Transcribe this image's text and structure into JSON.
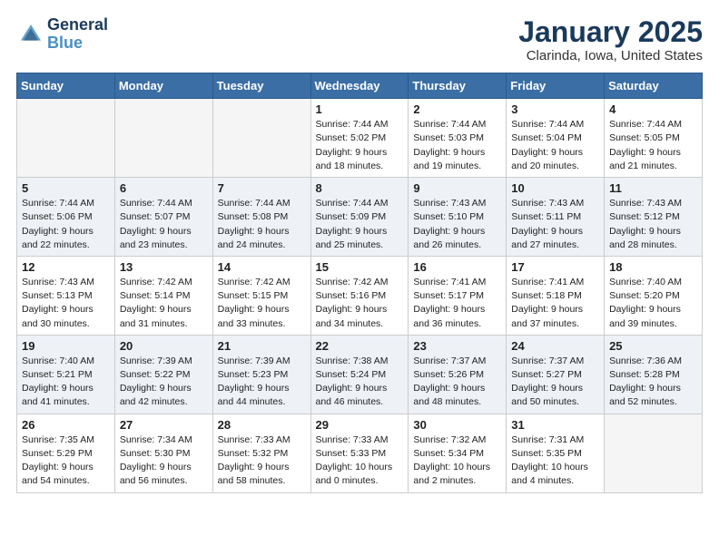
{
  "logo": {
    "line1": "General",
    "line2": "Blue"
  },
  "title": "January 2025",
  "location": "Clarinda, Iowa, United States",
  "days_of_week": [
    "Sunday",
    "Monday",
    "Tuesday",
    "Wednesday",
    "Thursday",
    "Friday",
    "Saturday"
  ],
  "weeks": [
    [
      {
        "day": "",
        "sunrise": "",
        "sunset": "",
        "daylight": "",
        "empty": true
      },
      {
        "day": "",
        "sunrise": "",
        "sunset": "",
        "daylight": "",
        "empty": true
      },
      {
        "day": "",
        "sunrise": "",
        "sunset": "",
        "daylight": "",
        "empty": true
      },
      {
        "day": "1",
        "sunrise": "Sunrise: 7:44 AM",
        "sunset": "Sunset: 5:02 PM",
        "daylight": "Daylight: 9 hours and 18 minutes.",
        "empty": false
      },
      {
        "day": "2",
        "sunrise": "Sunrise: 7:44 AM",
        "sunset": "Sunset: 5:03 PM",
        "daylight": "Daylight: 9 hours and 19 minutes.",
        "empty": false
      },
      {
        "day": "3",
        "sunrise": "Sunrise: 7:44 AM",
        "sunset": "Sunset: 5:04 PM",
        "daylight": "Daylight: 9 hours and 20 minutes.",
        "empty": false
      },
      {
        "day": "4",
        "sunrise": "Sunrise: 7:44 AM",
        "sunset": "Sunset: 5:05 PM",
        "daylight": "Daylight: 9 hours and 21 minutes.",
        "empty": false
      }
    ],
    [
      {
        "day": "5",
        "sunrise": "Sunrise: 7:44 AM",
        "sunset": "Sunset: 5:06 PM",
        "daylight": "Daylight: 9 hours and 22 minutes.",
        "empty": false
      },
      {
        "day": "6",
        "sunrise": "Sunrise: 7:44 AM",
        "sunset": "Sunset: 5:07 PM",
        "daylight": "Daylight: 9 hours and 23 minutes.",
        "empty": false
      },
      {
        "day": "7",
        "sunrise": "Sunrise: 7:44 AM",
        "sunset": "Sunset: 5:08 PM",
        "daylight": "Daylight: 9 hours and 24 minutes.",
        "empty": false
      },
      {
        "day": "8",
        "sunrise": "Sunrise: 7:44 AM",
        "sunset": "Sunset: 5:09 PM",
        "daylight": "Daylight: 9 hours and 25 minutes.",
        "empty": false
      },
      {
        "day": "9",
        "sunrise": "Sunrise: 7:43 AM",
        "sunset": "Sunset: 5:10 PM",
        "daylight": "Daylight: 9 hours and 26 minutes.",
        "empty": false
      },
      {
        "day": "10",
        "sunrise": "Sunrise: 7:43 AM",
        "sunset": "Sunset: 5:11 PM",
        "daylight": "Daylight: 9 hours and 27 minutes.",
        "empty": false
      },
      {
        "day": "11",
        "sunrise": "Sunrise: 7:43 AM",
        "sunset": "Sunset: 5:12 PM",
        "daylight": "Daylight: 9 hours and 28 minutes.",
        "empty": false
      }
    ],
    [
      {
        "day": "12",
        "sunrise": "Sunrise: 7:43 AM",
        "sunset": "Sunset: 5:13 PM",
        "daylight": "Daylight: 9 hours and 30 minutes.",
        "empty": false
      },
      {
        "day": "13",
        "sunrise": "Sunrise: 7:42 AM",
        "sunset": "Sunset: 5:14 PM",
        "daylight": "Daylight: 9 hours and 31 minutes.",
        "empty": false
      },
      {
        "day": "14",
        "sunrise": "Sunrise: 7:42 AM",
        "sunset": "Sunset: 5:15 PM",
        "daylight": "Daylight: 9 hours and 33 minutes.",
        "empty": false
      },
      {
        "day": "15",
        "sunrise": "Sunrise: 7:42 AM",
        "sunset": "Sunset: 5:16 PM",
        "daylight": "Daylight: 9 hours and 34 minutes.",
        "empty": false
      },
      {
        "day": "16",
        "sunrise": "Sunrise: 7:41 AM",
        "sunset": "Sunset: 5:17 PM",
        "daylight": "Daylight: 9 hours and 36 minutes.",
        "empty": false
      },
      {
        "day": "17",
        "sunrise": "Sunrise: 7:41 AM",
        "sunset": "Sunset: 5:18 PM",
        "daylight": "Daylight: 9 hours and 37 minutes.",
        "empty": false
      },
      {
        "day": "18",
        "sunrise": "Sunrise: 7:40 AM",
        "sunset": "Sunset: 5:20 PM",
        "daylight": "Daylight: 9 hours and 39 minutes.",
        "empty": false
      }
    ],
    [
      {
        "day": "19",
        "sunrise": "Sunrise: 7:40 AM",
        "sunset": "Sunset: 5:21 PM",
        "daylight": "Daylight: 9 hours and 41 minutes.",
        "empty": false
      },
      {
        "day": "20",
        "sunrise": "Sunrise: 7:39 AM",
        "sunset": "Sunset: 5:22 PM",
        "daylight": "Daylight: 9 hours and 42 minutes.",
        "empty": false
      },
      {
        "day": "21",
        "sunrise": "Sunrise: 7:39 AM",
        "sunset": "Sunset: 5:23 PM",
        "daylight": "Daylight: 9 hours and 44 minutes.",
        "empty": false
      },
      {
        "day": "22",
        "sunrise": "Sunrise: 7:38 AM",
        "sunset": "Sunset: 5:24 PM",
        "daylight": "Daylight: 9 hours and 46 minutes.",
        "empty": false
      },
      {
        "day": "23",
        "sunrise": "Sunrise: 7:37 AM",
        "sunset": "Sunset: 5:26 PM",
        "daylight": "Daylight: 9 hours and 48 minutes.",
        "empty": false
      },
      {
        "day": "24",
        "sunrise": "Sunrise: 7:37 AM",
        "sunset": "Sunset: 5:27 PM",
        "daylight": "Daylight: 9 hours and 50 minutes.",
        "empty": false
      },
      {
        "day": "25",
        "sunrise": "Sunrise: 7:36 AM",
        "sunset": "Sunset: 5:28 PM",
        "daylight": "Daylight: 9 hours and 52 minutes.",
        "empty": false
      }
    ],
    [
      {
        "day": "26",
        "sunrise": "Sunrise: 7:35 AM",
        "sunset": "Sunset: 5:29 PM",
        "daylight": "Daylight: 9 hours and 54 minutes.",
        "empty": false
      },
      {
        "day": "27",
        "sunrise": "Sunrise: 7:34 AM",
        "sunset": "Sunset: 5:30 PM",
        "daylight": "Daylight: 9 hours and 56 minutes.",
        "empty": false
      },
      {
        "day": "28",
        "sunrise": "Sunrise: 7:33 AM",
        "sunset": "Sunset: 5:32 PM",
        "daylight": "Daylight: 9 hours and 58 minutes.",
        "empty": false
      },
      {
        "day": "29",
        "sunrise": "Sunrise: 7:33 AM",
        "sunset": "Sunset: 5:33 PM",
        "daylight": "Daylight: 10 hours and 0 minutes.",
        "empty": false
      },
      {
        "day": "30",
        "sunrise": "Sunrise: 7:32 AM",
        "sunset": "Sunset: 5:34 PM",
        "daylight": "Daylight: 10 hours and 2 minutes.",
        "empty": false
      },
      {
        "day": "31",
        "sunrise": "Sunrise: 7:31 AM",
        "sunset": "Sunset: 5:35 PM",
        "daylight": "Daylight: 10 hours and 4 minutes.",
        "empty": false
      },
      {
        "day": "",
        "sunrise": "",
        "sunset": "",
        "daylight": "",
        "empty": true
      }
    ]
  ]
}
